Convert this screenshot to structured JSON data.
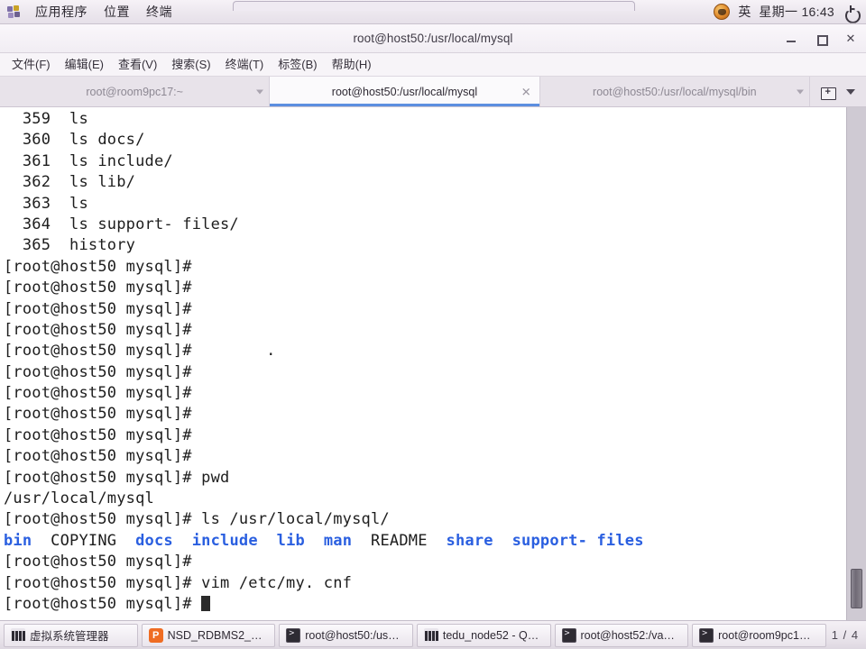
{
  "top_panel": {
    "apps_icon": "applications-grid-icon",
    "menus": [
      "应用程序",
      "位置",
      "终端"
    ],
    "ime": "英",
    "clock": "星期一 16:43",
    "power_icon": "power-icon",
    "indicator_icon": "sun-icon"
  },
  "window": {
    "title": "root@host50:/usr/local/mysql",
    "controls": {
      "minimize": "_",
      "maximize": "□",
      "close": "✕"
    }
  },
  "menu_bar": {
    "items": [
      "文件(F)",
      "编辑(E)",
      "查看(V)",
      "搜索(S)",
      "终端(T)",
      "标签(B)",
      "帮助(H)"
    ]
  },
  "tab_bar": {
    "tabs": [
      {
        "label": "root@room9pc17:~",
        "active": false
      },
      {
        "label": "root@host50:/usr/local/mysql",
        "active": true
      },
      {
        "label": "root@host50:/usr/local/mysql/bin",
        "active": false
      }
    ],
    "close_glyph": "✕",
    "new_tab_icon": "new-tab-icon",
    "chevron_icon": "chevron-down-icon",
    "accent_color": "#5c8fe0"
  },
  "terminal": {
    "prompt": "[root@host50 mysql]# ",
    "dir_color": "#2a5fe0",
    "text_color": "#1d1d1d",
    "background": "#ffffff",
    "history": [
      {
        "num": "359",
        "cmd": "ls"
      },
      {
        "num": "360",
        "cmd": "ls docs/"
      },
      {
        "num": "361",
        "cmd": "ls include/"
      },
      {
        "num": "362",
        "cmd": "ls lib/"
      },
      {
        "num": "363",
        "cmd": "ls"
      },
      {
        "num": "364",
        "cmd": "ls support- files/"
      },
      {
        "num": "365",
        "cmd": "history"
      }
    ],
    "empty_prompt_count_top": 4,
    "stray_dot": ".",
    "empty_prompt_count_mid": 5,
    "pwd_command": "pwd",
    "pwd_output": "/usr/local/mysql",
    "ls_command": "ls /usr/local/mysql/",
    "ls_entries": [
      {
        "name": "bin",
        "type": "dir"
      },
      {
        "name": "COPYING",
        "type": "file"
      },
      {
        "name": "docs",
        "type": "dir"
      },
      {
        "name": "include",
        "type": "dir"
      },
      {
        "name": "lib",
        "type": "dir"
      },
      {
        "name": "man",
        "type": "dir"
      },
      {
        "name": "README",
        "type": "file"
      },
      {
        "name": "share",
        "type": "dir"
      },
      {
        "name": "support- files",
        "type": "dir"
      }
    ],
    "vim_command": "vim /etc/my. cnf",
    "cursor": "block-cursor"
  },
  "taskbar": {
    "items": [
      {
        "label": "虚拟系统管理器",
        "icon": "vmm"
      },
      {
        "label": "NSD_RDBMS2_0…",
        "icon": "wps"
      },
      {
        "label": "root@host50:/us…",
        "icon": "term"
      },
      {
        "label": "tedu_node52 - Q…",
        "icon": "vmm"
      },
      {
        "label": "root@host52:/va…",
        "icon": "term"
      },
      {
        "label": "root@room9pc1…",
        "icon": "term"
      }
    ],
    "workspace": "1 / 4"
  }
}
